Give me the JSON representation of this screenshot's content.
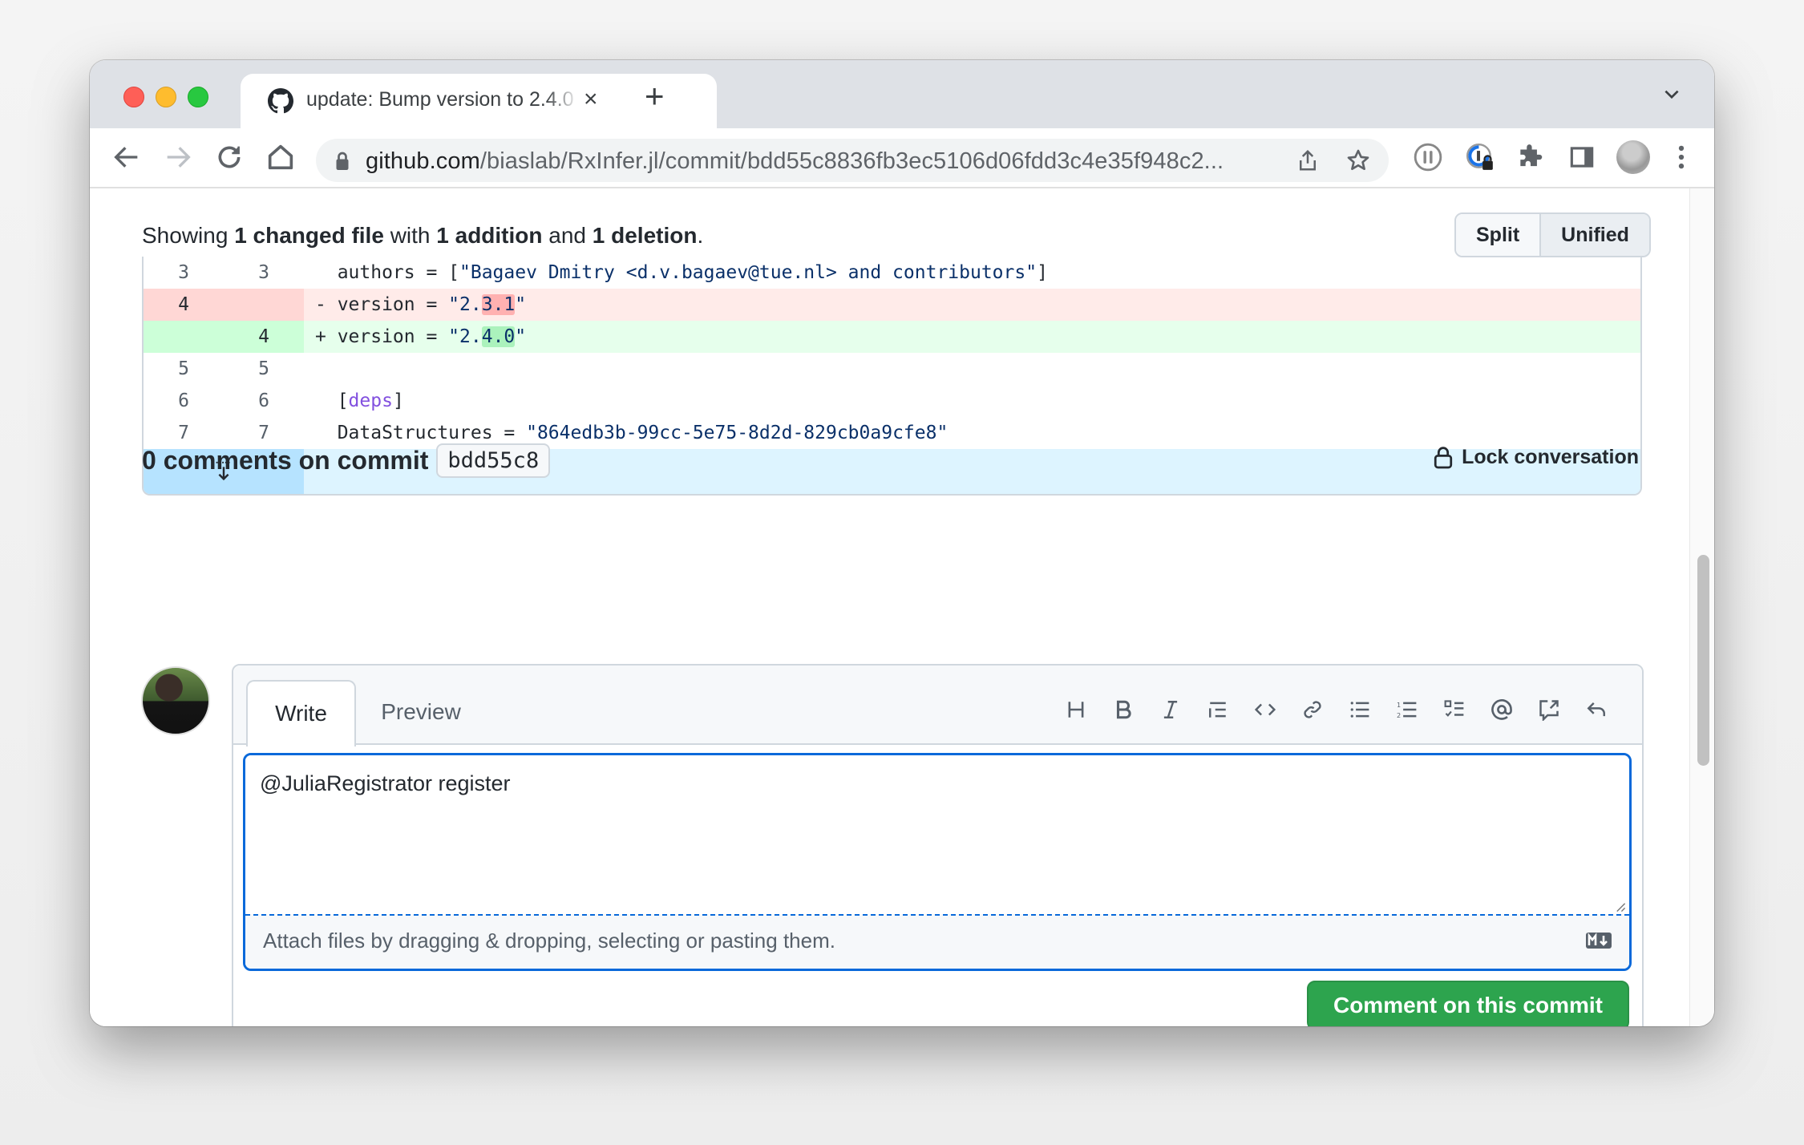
{
  "browser": {
    "tab": {
      "title": "update: Bump version to 2.4.0",
      "favicon": "github-icon",
      "close_label": "×"
    },
    "new_tab_label": "+",
    "url": {
      "host": "github.com",
      "path": "/biaslab/RxInfer.jl/commit/bdd55c8836fb3ec5106d06fdd3c4e35f948c2..."
    },
    "nav_icons": [
      "back-icon",
      "forward-icon",
      "reload-icon",
      "home-icon"
    ],
    "omnibox_icons": [
      "lock-icon",
      "share-icon",
      "star-icon"
    ],
    "extension_icons": [
      "pause-extension-icon",
      "password-manager-icon",
      "puzzle-extensions-icon",
      "side-panel-icon",
      "profile-avatar",
      "more-menu-icon"
    ]
  },
  "diff": {
    "summary": {
      "prefix": "Showing",
      "files": "1 changed file",
      "mid1": "with",
      "additions": "1 addition",
      "mid2": "and",
      "deletions": "1 deletion",
      "suffix": "."
    },
    "view_options": {
      "split": "Split",
      "unified": "Unified",
      "selected": "Unified"
    },
    "lines": [
      {
        "type": "context",
        "old": "3",
        "new": "3",
        "parts": [
          {
            "t": "  authors = [",
            "c": ""
          },
          {
            "t": "\"Bagaev Dmitry <d.v.bagaev@tue.nl> and contributors\"",
            "c": "str"
          },
          {
            "t": "]",
            "c": ""
          }
        ]
      },
      {
        "type": "del",
        "old": "4",
        "new": "",
        "parts": [
          {
            "t": "- version = ",
            "c": ""
          },
          {
            "t": "\"2.",
            "c": "str"
          },
          {
            "t": "3.1",
            "c": "str hl-del"
          },
          {
            "t": "\"",
            "c": "str"
          }
        ]
      },
      {
        "type": "add",
        "old": "",
        "new": "4",
        "parts": [
          {
            "t": "+ version = ",
            "c": ""
          },
          {
            "t": "\"2.",
            "c": "str"
          },
          {
            "t": "4.0",
            "c": "str hl-add"
          },
          {
            "t": "\"",
            "c": "str"
          }
        ]
      },
      {
        "type": "context",
        "old": "5",
        "new": "5",
        "parts": [
          {
            "t": "",
            "c": ""
          }
        ]
      },
      {
        "type": "context",
        "old": "6",
        "new": "6",
        "parts": [
          {
            "t": "  [",
            "c": ""
          },
          {
            "t": "deps",
            "c": "kw"
          },
          {
            "t": "]",
            "c": ""
          }
        ]
      },
      {
        "type": "context",
        "old": "7",
        "new": "7",
        "parts": [
          {
            "t": "  DataStructures = ",
            "c": ""
          },
          {
            "t": "\"864edb3b-99cc-5e75-8d2d-829cb0a9cfe8\"",
            "c": "str"
          }
        ]
      }
    ],
    "expand_icon": "expand-down-icon"
  },
  "comments": {
    "title": "0 comments on commit",
    "sha": "bdd55c8",
    "lock_label": "Lock conversation"
  },
  "composer": {
    "tabs": {
      "write": "Write",
      "preview": "Preview",
      "active": "Write"
    },
    "toolbar": [
      "heading-icon",
      "bold-icon",
      "italic-icon",
      "quote-icon",
      "code-icon",
      "link-icon",
      "unordered-list-icon",
      "ordered-list-icon",
      "task-list-icon",
      "mention-icon",
      "reference-icon",
      "reply-icon"
    ],
    "value": "@JuliaRegistrator register",
    "attach_text": "Attach files by dragging & dropping, selecting or pasting them.",
    "markdown_badge": "markdown-icon",
    "submit_label": "Comment on this commit"
  },
  "colors": {
    "accent_blue": "#0969da",
    "submit_green": "#2da44e",
    "deletion_bg": "#ffebe9",
    "addition_bg": "#e6ffec",
    "expand_bg": "#ddf4ff"
  }
}
